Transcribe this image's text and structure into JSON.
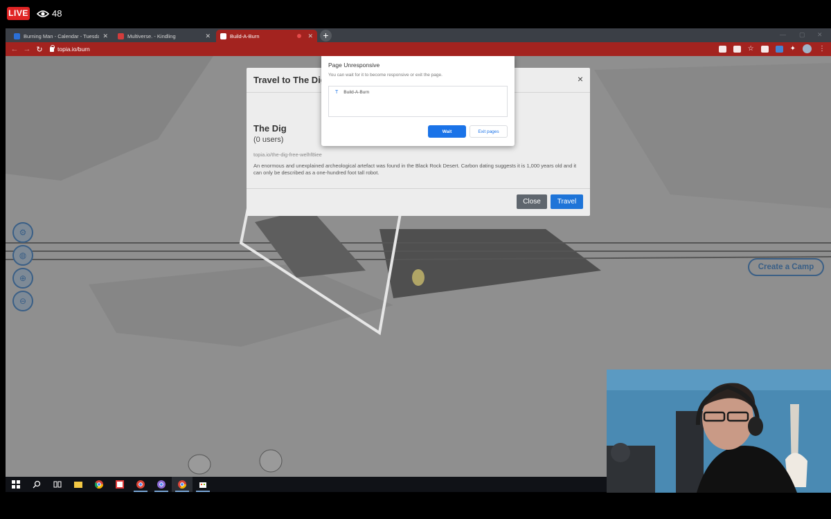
{
  "live": {
    "badge": "LIVE",
    "viewer_count": "48"
  },
  "browser": {
    "tabs": [
      {
        "title": "Burning Man - Calendar - Tuesda",
        "favicon_color": "#2b6fd6"
      },
      {
        "title": "Multiverse. - Kindling",
        "favicon_color": "#d23c3c"
      },
      {
        "title": "Build-A-Burn",
        "favicon_color": "#ffffff"
      }
    ],
    "new_tab_label": "+",
    "url": "topia.io/burn",
    "accent_color": "#a3231f"
  },
  "map": {
    "create_camp_label": "Create a Camp"
  },
  "travel_modal": {
    "title": "Travel to The Dig",
    "close_x": "×",
    "destination_name": "The Dig",
    "user_count": "(0 users)",
    "url": "topia.io/the-dig-free-welhf8iee",
    "description": "An enormous and unexplained archeological artefact was found in the Black Rock Desert. Carbon dating suggests it is 1,000 years old and it can only be described as a one-hundred foot tall robot.",
    "close_button": "Close",
    "travel_button": "Travel"
  },
  "unresponsive_dialog": {
    "title": "Page Unresponsive",
    "subtitle": "You can wait for it to become responsive or exit the page.",
    "page_icon": "T",
    "page_name": "Build-A-Burn",
    "wait_button": "Wait",
    "exit_button": "Exit pages"
  },
  "taskbar_icons": [
    "windows-start-icon",
    "search-icon",
    "task-view-icon",
    "file-explorer-icon",
    "chrome-icon",
    "app-grid-icon",
    "chrome-profile-icon",
    "chrome-profile-2-icon",
    "chrome-active-icon",
    "store-icon"
  ]
}
